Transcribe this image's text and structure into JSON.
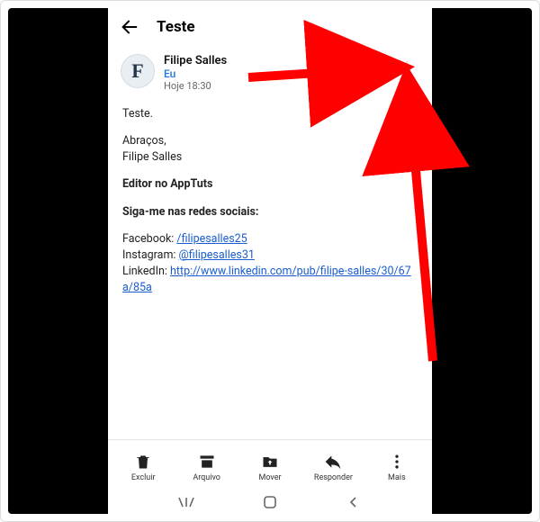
{
  "header": {
    "title": "Teste"
  },
  "message": {
    "avatar_letter": "F",
    "sender": "Filipe Salles",
    "recipient": "Eu",
    "timestamp": "Hoje 18:30"
  },
  "body": {
    "greeting": "Teste.",
    "signoff_line1": "Abraços,",
    "signoff_line2": "Filipe Salles",
    "role": "Editor no AppTuts",
    "social_heading": "Siga-me nas redes sociais:",
    "facebook_label": "Facebook: ",
    "facebook_link": "/filipesalles25",
    "instagram_label": "Instagram: ",
    "instagram_link": "@filipesalles31",
    "linkedin_label": "LinkedIn: ",
    "linkedin_link": "http://www.linkedin.com/pub/filipe-salles/30/67a/85a"
  },
  "toolbar": {
    "delete": "Excluir",
    "archive": "Arquivo",
    "move": "Mover",
    "reply": "Responder",
    "more": "Mais"
  },
  "colors": {
    "link": "#1a5dd0",
    "accent": "#1a73e8",
    "annotation": "#ff0000"
  }
}
